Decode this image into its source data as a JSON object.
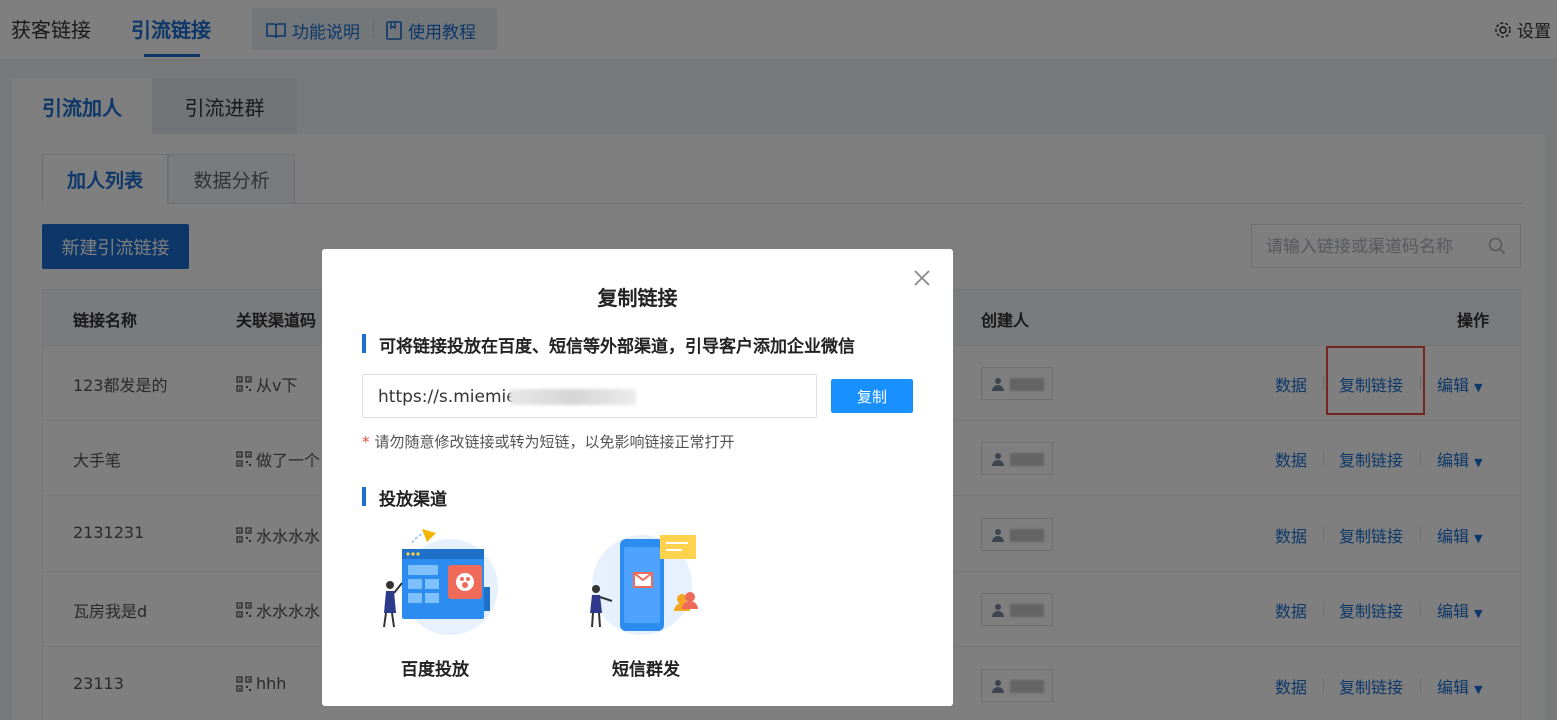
{
  "topbar": {
    "tabs": [
      "获客链接",
      "引流链接"
    ],
    "help_items": [
      "功能说明",
      "使用教程"
    ],
    "settings_label": "设置"
  },
  "card_tabs": [
    "引流加人",
    "引流进群"
  ],
  "sub_tabs": [
    "加人列表",
    "数据分析"
  ],
  "new_button": "新建引流链接",
  "search": {
    "placeholder": "请输入链接或渠道码名称"
  },
  "table": {
    "headers": [
      "链接名称",
      "关联渠道码",
      "创建人",
      "操作"
    ],
    "rows": [
      {
        "name": "123都发是的",
        "channel": "从v下"
      },
      {
        "name": "大手笔",
        "channel": "做了一个"
      },
      {
        "name": "2131231",
        "channel": "水水水水"
      },
      {
        "name": "瓦房我是d",
        "channel": "水水水水"
      },
      {
        "name": "23113",
        "channel": "hhh"
      }
    ],
    "actions": {
      "data": "数据",
      "copy": "复制链接",
      "edit": "编辑"
    }
  },
  "modal": {
    "title": "复制链接",
    "section1": "可将链接投放在百度、短信等外部渠道，引导客户添加企业微信",
    "link_text": "https://s.miemie.",
    "copy_button": "复制",
    "warning": "请勿随意修改链接或转为短链，以免影响链接正常打开",
    "section2": "投放渠道",
    "channels": [
      "百度投放",
      "短信群发"
    ]
  },
  "colors": {
    "primary": "#1a6fd1",
    "button": "#1890ff",
    "highlight": "#e74c3c"
  }
}
